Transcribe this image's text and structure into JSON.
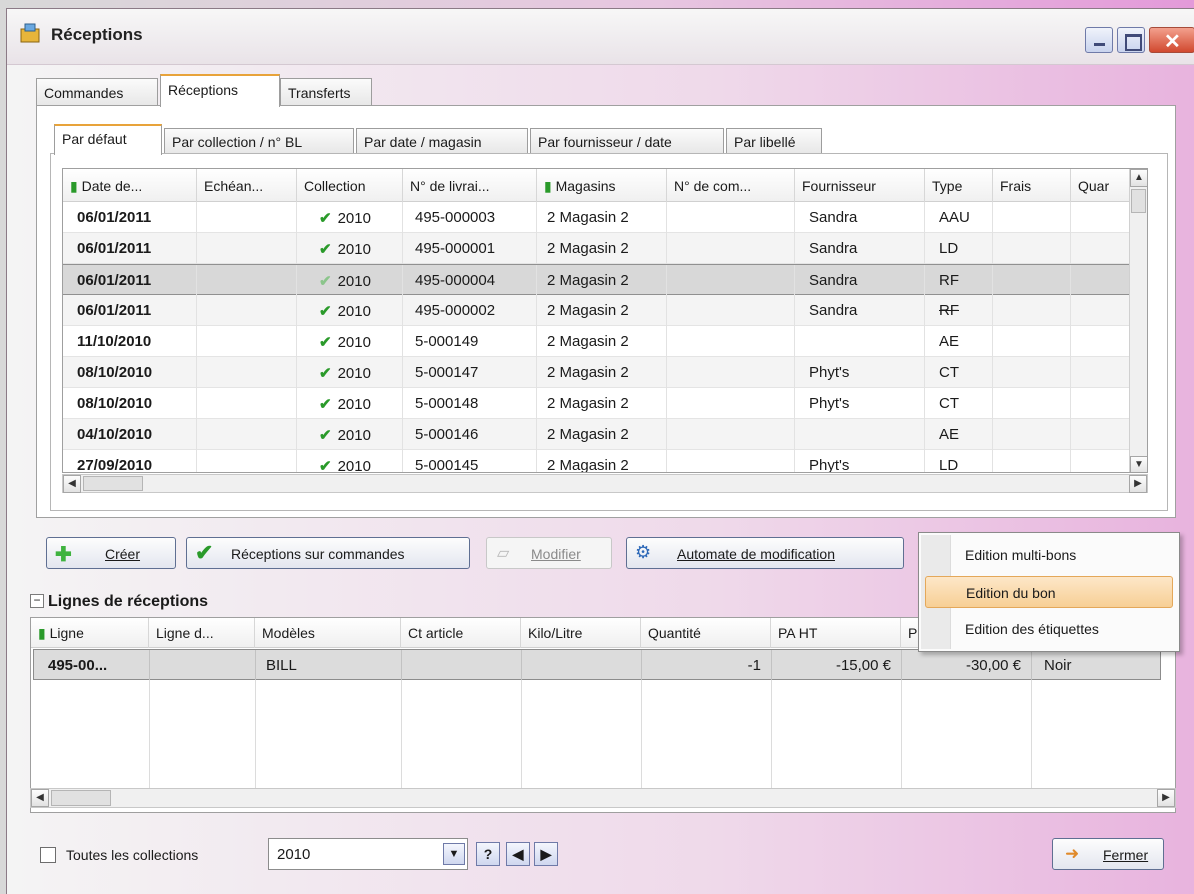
{
  "window": {
    "title": "Réceptions"
  },
  "tabs": [
    "Commandes",
    "Réceptions",
    "Transferts"
  ],
  "subtabs": [
    "Par défaut",
    "Par collection / n° BL",
    "Par date / magasin",
    "Par fournisseur / date",
    "Par libellé"
  ],
  "receptions_grid": {
    "columns": [
      "Date de...",
      "Echéan...",
      "Collection",
      "N° de livrai...",
      "Magasins",
      "N° de com...",
      "Fournisseur",
      "Type",
      "Frais",
      "Quar"
    ],
    "rows": [
      {
        "date": "06/01/2011",
        "collection": "2010",
        "bl": "495-000003",
        "magasin": "2 Magasin 2",
        "fournisseur": "Sandra",
        "type": "AAU"
      },
      {
        "date": "06/01/2011",
        "collection": "2010",
        "bl": "495-000001",
        "magasin": "2 Magasin 2",
        "fournisseur": "Sandra",
        "type": "LD"
      },
      {
        "date": "06/01/2011",
        "collection": "2010",
        "bl": "495-000004",
        "magasin": "2 Magasin 2",
        "fournisseur": "Sandra",
        "type": "RF"
      },
      {
        "date": "06/01/2011",
        "collection": "2010",
        "bl": "495-000002",
        "magasin": "2 Magasin 2",
        "fournisseur": "Sandra",
        "type": "RF"
      },
      {
        "date": "11/10/2010",
        "collection": "2010",
        "bl": "5-000149",
        "magasin": "2 Magasin 2",
        "fournisseur": "",
        "type": "AE"
      },
      {
        "date": "08/10/2010",
        "collection": "2010",
        "bl": "5-000147",
        "magasin": "2 Magasin 2",
        "fournisseur": "Phyt's",
        "type": "CT"
      },
      {
        "date": "08/10/2010",
        "collection": "2010",
        "bl": "5-000148",
        "magasin": "2 Magasin 2",
        "fournisseur": "Phyt's",
        "type": "CT"
      },
      {
        "date": "04/10/2010",
        "collection": "2010",
        "bl": "5-000146",
        "magasin": "2 Magasin 2",
        "fournisseur": "",
        "type": "AE"
      },
      {
        "date": "27/09/2010",
        "collection": "2010",
        "bl": "5-000145",
        "magasin": "2 Magasin 2",
        "fournisseur": "Phyt's",
        "type": "LD"
      }
    ]
  },
  "buttons": {
    "creer": "Créer",
    "receptions_commandes": "Réceptions sur commandes",
    "modifier": "Modifier",
    "automate": "Automate de modification",
    "fermer": "Fermer"
  },
  "context_menu": [
    "Edition multi-bons",
    "Edition du bon",
    "Edition des étiquettes"
  ],
  "lines_section": {
    "title": "Lignes de réceptions",
    "columns": [
      "Ligne",
      "Ligne d...",
      "Modèles",
      "Ct article",
      "Kilo/Litre",
      "Quantité",
      "PA HT",
      "P"
    ],
    "row": {
      "ligne": "495-00...",
      "modele": "BILL",
      "quantite": "-1",
      "pa_ht": "-15,00 €",
      "total": "-30,00 €",
      "couleur": "Noir"
    }
  },
  "footer": {
    "checkbox_label": "Toutes les collections",
    "collection_value": "2010",
    "help": "?"
  },
  "colors": {
    "accent_tab": "#e8a33a",
    "check_green": "#2a9a2a",
    "menu_highlight": "#f7cf95"
  }
}
